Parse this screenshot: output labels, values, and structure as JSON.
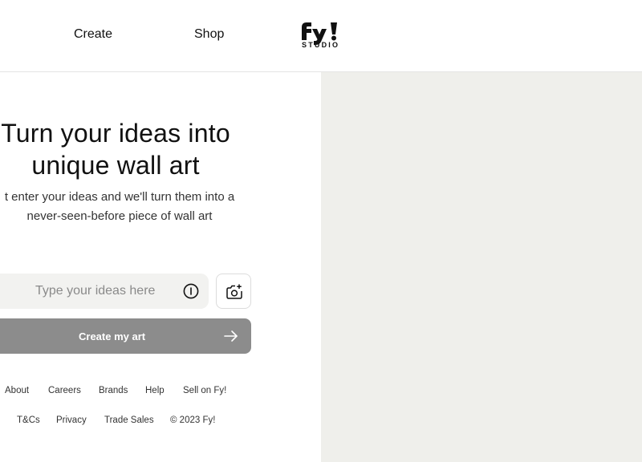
{
  "header": {
    "nav": [
      {
        "label": "Create"
      },
      {
        "label": "Shop"
      }
    ],
    "logo": {
      "mark": "fy!",
      "sub": "STUDIO",
      "icon": "fy-studio-logo"
    }
  },
  "hero": {
    "title_line1": "Turn your ideas into",
    "title_line2": "unique wall art",
    "subtitle_line1": "t enter your ideas and we'll turn them into a",
    "subtitle_line2": "never-seen-before piece of wall art"
  },
  "input": {
    "placeholder": "Type your ideas here",
    "value": "",
    "info_icon": "info-circle-icon",
    "camera_icon": "camera-add-icon"
  },
  "create_button": {
    "label": "Create my art",
    "icon": "arrow-right-icon",
    "color": "#8c8c8c"
  },
  "footer": {
    "row1": [
      "About",
      "Careers",
      "Brands",
      "Help",
      "Sell on Fy!"
    ],
    "row2": [
      "T&Cs",
      "Privacy",
      "Trade Sales",
      "© 2023 Fy!"
    ]
  },
  "colors": {
    "right_panel_bg": "#efefeb",
    "input_bg": "#f2f2f0"
  }
}
